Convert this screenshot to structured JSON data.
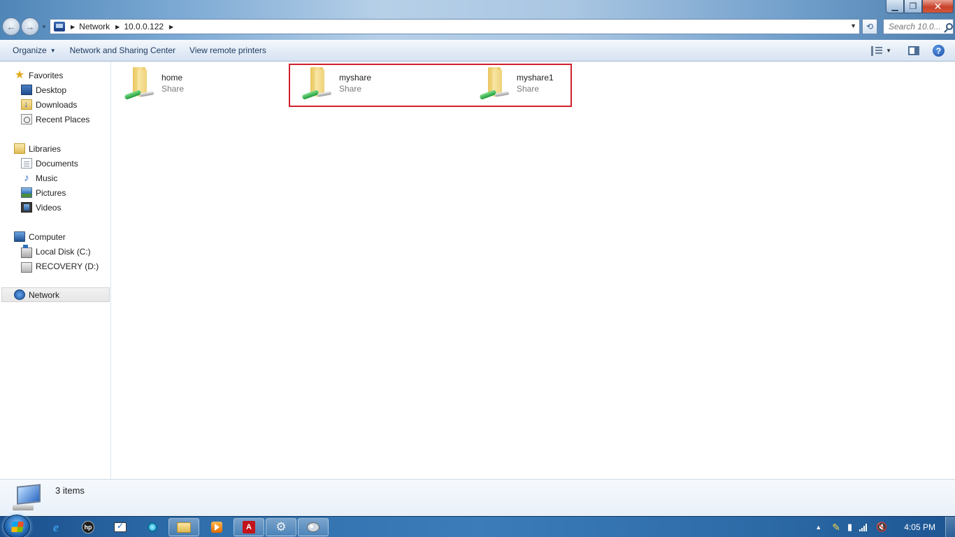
{
  "address_bar": {
    "crumbs": [
      "Network",
      "10.0.0.122"
    ],
    "search_placeholder": "Search 10.0..."
  },
  "caption": {
    "minimize": "▁",
    "maximize": "❐",
    "close": "✕"
  },
  "command_bar": {
    "organize": "Organize",
    "network_sharing_center": "Network and Sharing Center",
    "view_remote_printers": "View remote printers",
    "help": "?"
  },
  "nav_pane": {
    "favorites": {
      "label": "Favorites",
      "items": [
        "Desktop",
        "Downloads",
        "Recent Places"
      ]
    },
    "libraries": {
      "label": "Libraries",
      "items": [
        "Documents",
        "Music",
        "Pictures",
        "Videos"
      ]
    },
    "computer": {
      "label": "Computer",
      "items": [
        "Local Disk (C:)",
        "RECOVERY (D:)"
      ]
    },
    "network": {
      "label": "Network"
    }
  },
  "content": {
    "items": [
      {
        "name": "home",
        "type": "Share"
      },
      {
        "name": "myshare",
        "type": "Share"
      },
      {
        "name": "myshare1",
        "type": "Share"
      }
    ]
  },
  "details": {
    "count": "3 items"
  },
  "taskbar": {
    "pdf_label": "A",
    "hp_label": "hp",
    "clock": "4:05 PM"
  },
  "colors": {
    "highlight": "#d0202e",
    "titlebar": "#7aa8d3",
    "taskbar": "#2f6eab"
  }
}
